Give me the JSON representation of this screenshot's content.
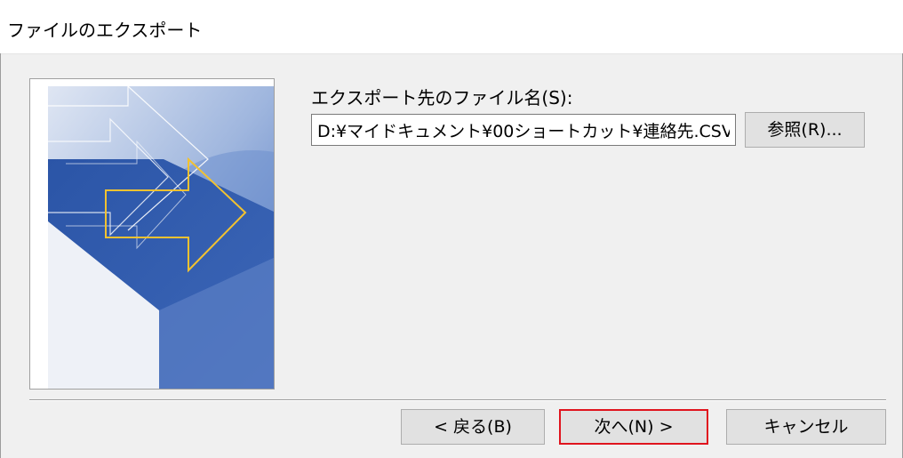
{
  "window": {
    "title": "ファイルのエクスポート"
  },
  "form": {
    "label": "エクスポート先のファイル名(S):",
    "path_value": "D:¥マイドキュメント¥00ショートカット¥連絡先.CSV",
    "browse_label": "参照(R)..."
  },
  "footer": {
    "back_label": "< 戻る(B)",
    "next_label": "次へ(N) >",
    "cancel_label": "キャンセル"
  },
  "colors": {
    "highlight_border": "#e0141e",
    "art_blue": "#2f5cae",
    "arrow_yellow": "#f2c230"
  }
}
